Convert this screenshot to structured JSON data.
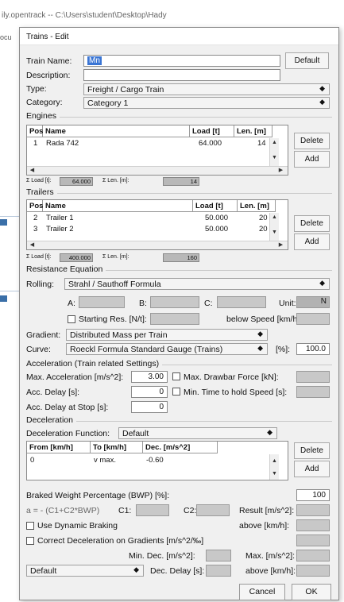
{
  "bg_window": {
    "title": "ily.opentrack  --  C:\\Users\\student\\Desktop\\Hady",
    "tab_fragment": "ocu"
  },
  "dialog": {
    "title": "Trains - Edit",
    "train_name_label": "Train Name:",
    "train_name_value": "Mn",
    "default_button": "Default",
    "description_label": "Description:",
    "description_value": "",
    "type_label": "Type:",
    "type_value": "Freight / Cargo Train",
    "category_label": "Category:",
    "category_value": "Category 1"
  },
  "engines": {
    "group_label": "Engines",
    "columns": [
      "Pos.",
      "Name",
      "Load [t]",
      "Len. [m]"
    ],
    "rows": [
      {
        "pos": "1",
        "name": "Rada 742",
        "load": "64.000",
        "len": "14"
      }
    ],
    "delete_label": "Delete",
    "add_label": "Add",
    "sum_load_label": "Σ Load [t]:",
    "sum_load_value": "64.000",
    "sum_len_label": "Σ Len. [m]:",
    "sum_len_value": "14"
  },
  "trailers": {
    "group_label": "Trailers",
    "columns": [
      "Pos.",
      "Name",
      "Load [t]",
      "Len. [m]"
    ],
    "rows": [
      {
        "pos": "2",
        "name": "Trailer 1",
        "load": "50.000",
        "len": "20"
      },
      {
        "pos": "3",
        "name": "Trailer 2",
        "load": "50.000",
        "len": "20"
      }
    ],
    "delete_label": "Delete",
    "add_label": "Add",
    "sum_load_label": "Σ Load [t]:",
    "sum_load_value": "400.000",
    "sum_len_label": "Σ Len. [m]:",
    "sum_len_value": "160"
  },
  "resistance": {
    "group_label": "Resistance Equation",
    "rolling_label": "Rolling:",
    "rolling_value": "Strahl / Sauthoff Formula",
    "a_label": "A:",
    "b_label": "B:",
    "c_label": "C:",
    "unit_label": "Unit:",
    "unit_value": "N",
    "starting_res_label": "Starting Res. [N/t]:",
    "below_speed_label": "below Speed [km/h]:",
    "gradient_label": "Gradient:",
    "gradient_value": "Distributed Mass per Train",
    "curve_label": "Curve:",
    "curve_value": "Roeckl Formula Standard Gauge (Trains)",
    "percent_label": "[%]:",
    "percent_value": "100.0"
  },
  "acceleration": {
    "group_label": "Acceleration (Train related Settings)",
    "max_acc_label": "Max. Acceleration [m/s^2]:",
    "max_acc_value": "3.00",
    "max_drawbar_label": "Max. Drawbar Force [kN]:",
    "acc_delay_label": "Acc. Delay [s]:",
    "acc_delay_value": "0",
    "min_time_label": "Min. Time to hold Speed [s]:",
    "acc_delay_stop_label": "Acc. Delay at Stop [s]:",
    "acc_delay_stop_value": "0"
  },
  "deceleration": {
    "group_label": "Deceleration",
    "function_label": "Deceleration Function:",
    "function_value": "Default",
    "columns": [
      "From [km/h]",
      "To [km/h]",
      "Dec. [m/s^2]"
    ],
    "rows": [
      {
        "from": "0",
        "to": "v max.",
        "dec": "-0.60"
      }
    ],
    "delete_label": "Delete",
    "add_label": "Add",
    "bwp_label": "Braked Weight Percentage (BWP) [%]:",
    "bwp_value": "100",
    "formula_label": "a = - (C1+C2*BWP)",
    "c1_label": "C1:",
    "c2_label": "C2:",
    "result_label": "Result [m/s^2]:",
    "dynamic_braking_label": "Use Dynamic Braking",
    "above_label_1": "above [km/h]:",
    "correct_dec_label": "Correct Deceleration on Gradients [m/s^2/‰]",
    "min_dec_label": "Min. Dec. [m/s^2]:",
    "max_dec_label": "Max. [m/s^2]:",
    "bottom_combo_value": "Default",
    "dec_delay_label": "Dec. Delay [s]:",
    "above_label_2": "above [km/h]:"
  },
  "footer": {
    "cancel_label": "Cancel",
    "ok_label": "OK"
  }
}
